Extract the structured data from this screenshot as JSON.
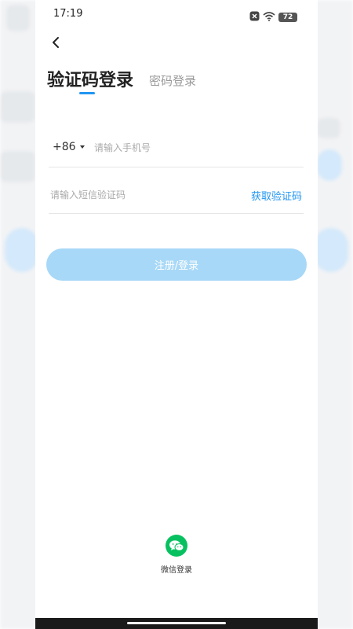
{
  "status_bar": {
    "time": "17:19",
    "battery": "72",
    "icons": [
      "notification-x-icon",
      "wifi-icon",
      "battery-icon"
    ]
  },
  "header": {
    "back_icon": "chevron-left-icon"
  },
  "tabs": [
    {
      "label": "验证码登录",
      "active": true
    },
    {
      "label": "密码登录",
      "active": false
    }
  ],
  "form": {
    "country_code": "+86",
    "phone_placeholder": "请输入手机号",
    "code_placeholder": "请输入短信验证码",
    "get_code_label": "获取验证码",
    "submit_label": "注册/登录"
  },
  "third_party": {
    "wechat_label": "微信登录"
  },
  "colors": {
    "accent": "#2196f3",
    "submit_disabled": "#a8d8f7",
    "wechat": "#07c160"
  }
}
